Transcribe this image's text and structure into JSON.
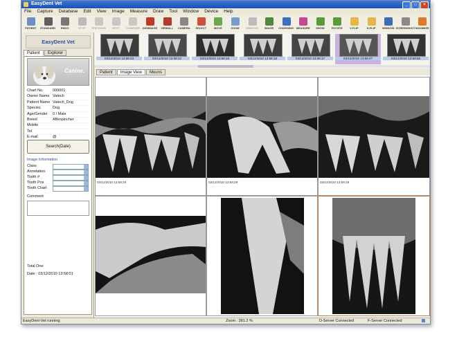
{
  "app": {
    "title": "EasyDent Vet"
  },
  "menu": [
    "File",
    "Capture",
    "Database",
    "Edit",
    "View",
    "Image",
    "Measure",
    "Draw",
    "Tool",
    "Window",
    "Device",
    "Help"
  ],
  "toolbar": [
    {
      "label": "PATIENT",
      "color": "#6c8dc7",
      "disabled": false
    },
    {
      "label": "STANDARD",
      "color": "#5f5f5f",
      "disabled": false
    },
    {
      "label": "ENDO",
      "color": "#777777",
      "disabled": false
    },
    {
      "label": "STOP",
      "color": "#bbbbbb",
      "disabled": true
    },
    {
      "label": "PREVIOUS",
      "color": "#c7c7c7",
      "disabled": true
    },
    {
      "label": "NEXT",
      "color": "#c7c7c7",
      "disabled": true
    },
    {
      "label": "COMPARE",
      "color": "#c7c7c7",
      "disabled": true
    },
    {
      "label": "DIGIIMAGE",
      "color": "#c0392b",
      "disabled": false
    },
    {
      "label": "VIEWALL",
      "color": "#b23a2e",
      "disabled": false
    },
    {
      "label": "CAMERA",
      "color": "#888888",
      "disabled": false
    },
    {
      "label": "SELECT",
      "color": "#d24e3b",
      "disabled": false
    },
    {
      "label": "MOVE",
      "color": "#6ca84e",
      "disabled": false
    },
    {
      "label": "ZOOM",
      "color": "#7a9bd0",
      "disabled": false
    },
    {
      "label": "WINDOW",
      "color": "#bbbbbb",
      "disabled": true
    },
    {
      "label": "IMAGE",
      "color": "#4f8a3c",
      "disabled": false
    },
    {
      "label": "CHARGING",
      "color": "#3d6fc0",
      "disabled": false
    },
    {
      "label": "MEASURE",
      "color": "#c44a8f",
      "disabled": false
    },
    {
      "label": "SHOW",
      "color": "#5b9b3a",
      "disabled": false
    },
    {
      "label": "ROTATE",
      "color": "#5b9b3a",
      "disabled": false
    },
    {
      "label": "V-FLIP",
      "color": "#e5b64a",
      "disabled": false
    },
    {
      "label": "H-FLIP",
      "color": "#e5b64a",
      "disabled": false
    },
    {
      "label": "WINDOW",
      "color": "#3e6db4",
      "disabled": false
    },
    {
      "label": "SCREENSHOT",
      "color": "#8a8a8a",
      "disabled": false
    },
    {
      "label": "MAXIMIZE",
      "color": "#e07a2a",
      "disabled": false
    }
  ],
  "left": {
    "logo": "EasyDent Vet",
    "tabs": [
      "Patient",
      "Explorer"
    ],
    "photo_text": "Canine.",
    "fields": [
      {
        "k": "Chart No.",
        "v": "000001"
      },
      {
        "k": "Owner Name",
        "v": "Vatech"
      },
      {
        "k": "Patient Name",
        "v": "Vatech_Dog"
      },
      {
        "k": "Species",
        "v": "Dog"
      },
      {
        "k": "Age/Gender",
        "v": "0 / Male"
      },
      {
        "k": "Breed",
        "v": "Affenpincher"
      },
      {
        "k": "Mobile",
        "v": ""
      },
      {
        "k": "Tel",
        "v": ""
      },
      {
        "k": "E-mail",
        "v": "@"
      }
    ],
    "search_label": "Search(Date)",
    "image_info_title": "Image Information",
    "image_info_fields": [
      "Class",
      "Annotation",
      "Tooth #",
      "Tooth Pos",
      "Tooth Chart"
    ],
    "comment_label": "Comment",
    "total_label": "Total One",
    "date_label": "Date : 03/12/2010 13:58:01"
  },
  "thumbnails": [
    {
      "caption": "03/12/2010 13:58:23",
      "selected": false
    },
    {
      "caption": "03/12/2010 13:58:24",
      "selected": false
    },
    {
      "caption": "03/12/2010 13:59:18",
      "selected": false
    },
    {
      "caption": "03/12/2010 13:58:18",
      "selected": false
    },
    {
      "caption": "03/12/2010 13:58:17",
      "selected": false
    },
    {
      "caption": "03/12/2010 13:58:47",
      "selected": true
    },
    {
      "caption": "03/12/2010 13:58:55",
      "selected": false
    }
  ],
  "view_tabs": [
    "Patient",
    "Image View",
    "Mouns"
  ],
  "grid_captions": [
    "03/12/2010 13:58:29",
    "03/12/2010 13:58:29",
    "03/12/2010 13:58:18"
  ],
  "status": {
    "left": "EasyDent-Vet running",
    "zoom": "Zoom : 361.2 %",
    "dserver": "D-Server Connected",
    "fserver": "F-Server Connected"
  },
  "colors": {
    "titlebar": "#1c4fb5",
    "selected_thumb": "#c9b2e0",
    "accent": "#2a4f9e"
  }
}
